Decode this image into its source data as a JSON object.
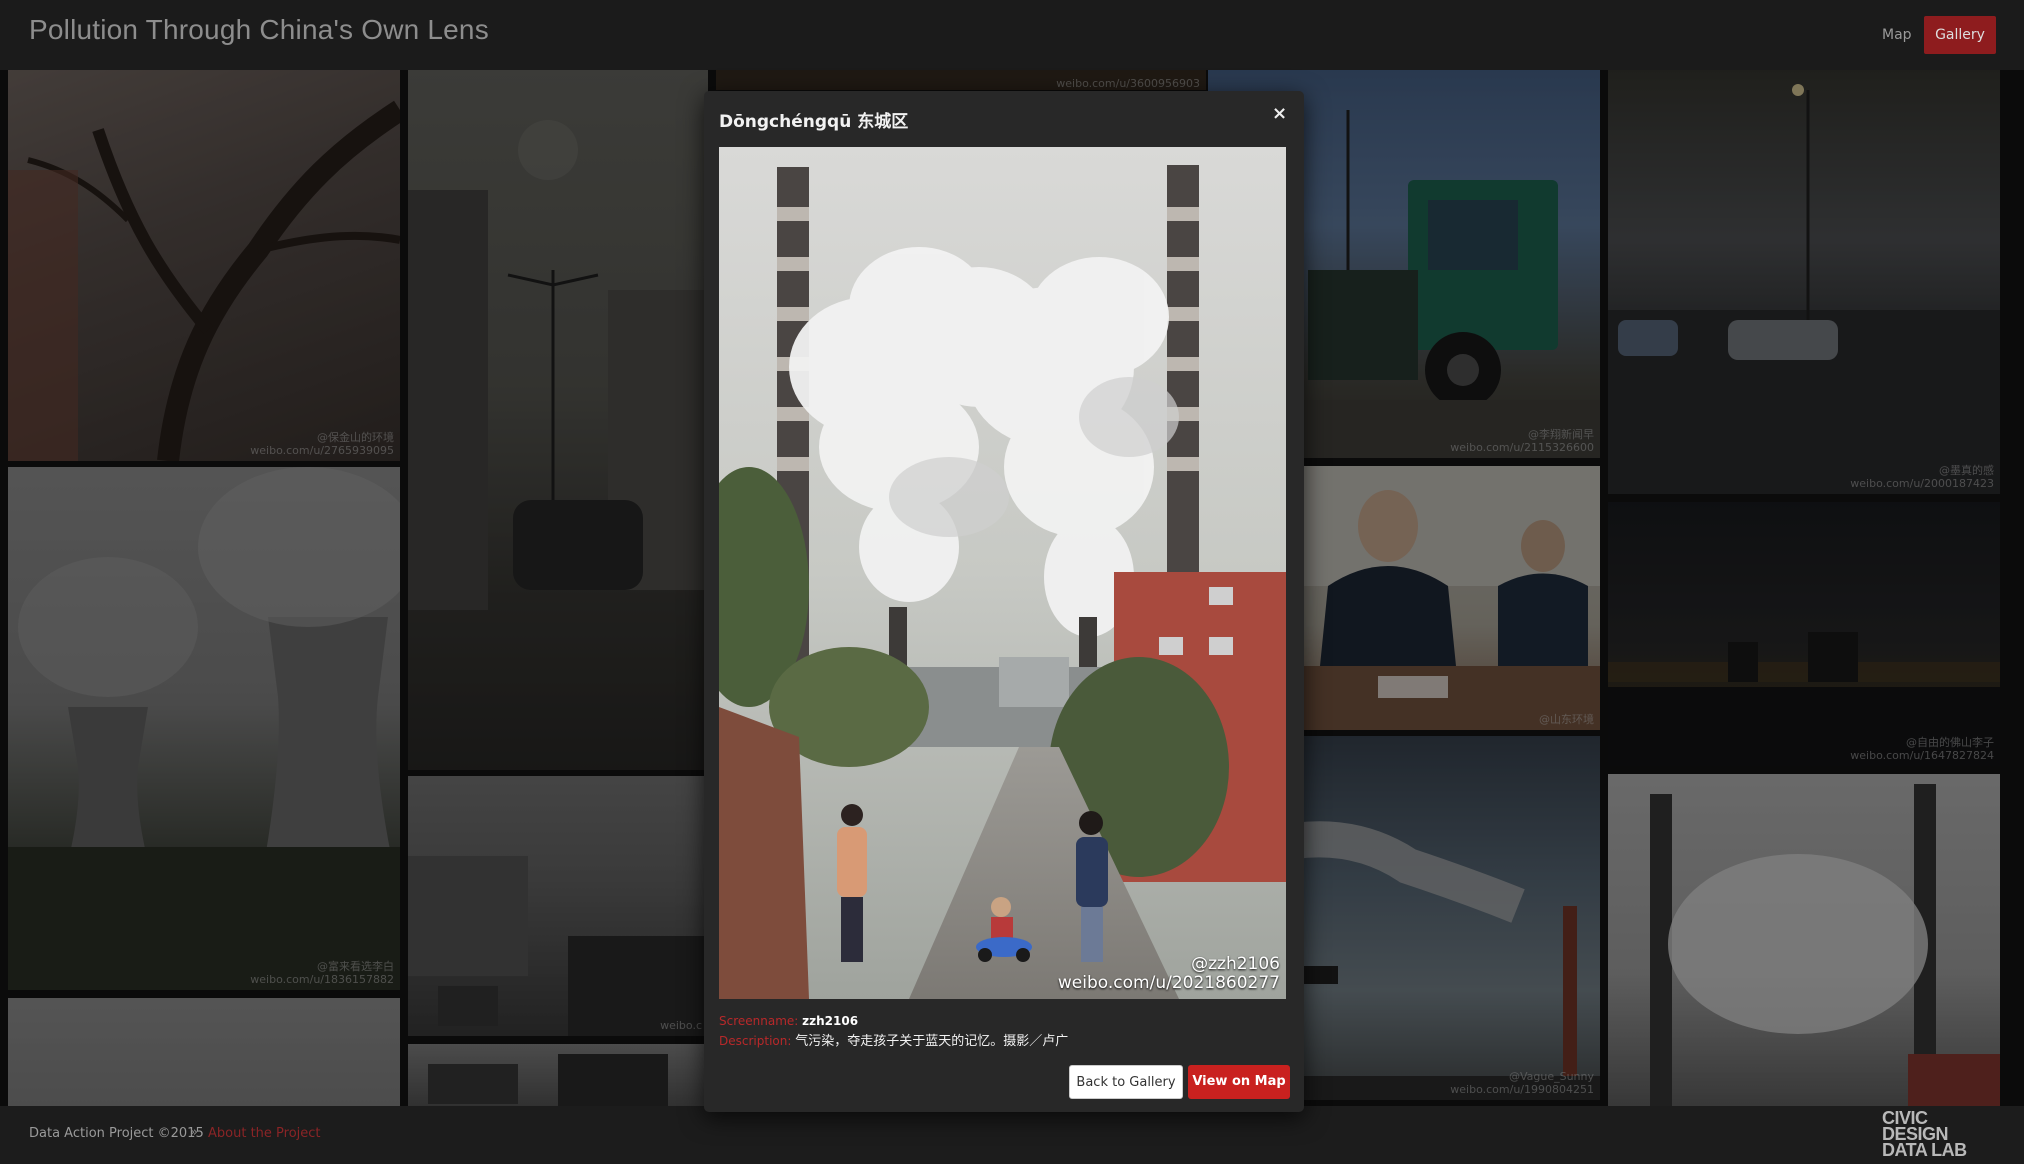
{
  "header": {
    "brand": "Pollution Through China's Own Lens",
    "nav": {
      "map": "Map",
      "gallery": "Gallery"
    }
  },
  "gallery": {
    "watermarks": {
      "t1": "weibo.com/u/2765939095",
      "t1h": "@保金山的环境",
      "t2": "weibo.com/u/1836157882",
      "t2h": "@富来看选李白",
      "t3": "weibo.com/u/3600956903",
      "t4": "weibo.com/u/2115326600",
      "t4h": "@李翔新闻早",
      "t5": "@山东环境",
      "t6h": "@Vague_Sunny",
      "t6": "weibo.com/u/1990804251",
      "t7": "weibo.com/u/2000187423",
      "t7h": "@墨真的感",
      "t8": "weibo.com/u/1647827824",
      "t8h": "@自由的佛山李子",
      "t9": "weibo.c"
    }
  },
  "modal": {
    "title": "Dōngchéngqū 东城区",
    "close": "×",
    "photo_handle": "@zzh2106",
    "photo_url": "weibo.com/u/2021860277",
    "screenname_label": "Screenname:",
    "screenname": "zzh2106",
    "description_label": "Description:",
    "description": "气污染，夺走孩子关于蓝天的记忆。摄影／卢广",
    "back_button": "Back to Gallery",
    "map_button": "View on Map"
  },
  "footer": {
    "copyright": "Data Action Project ©2015",
    "separator": "»",
    "about": "About the Project",
    "logo_line1": "CIVIC DESIGN",
    "logo_line2": "DATA LAB"
  }
}
